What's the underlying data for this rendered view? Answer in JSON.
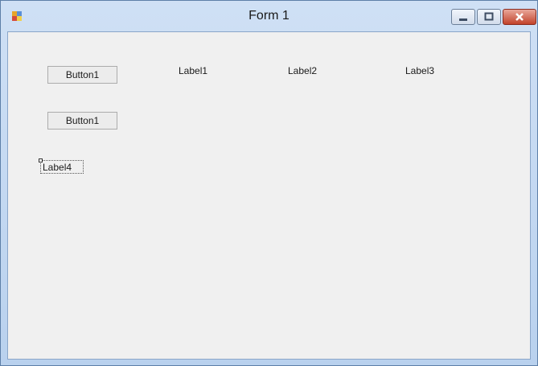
{
  "window": {
    "title": "Form 1",
    "icon": "winforms-form-icon",
    "controls": {
      "minimize": "minimize-icon",
      "maximize": "maximize-icon",
      "close": "close-icon"
    }
  },
  "form": {
    "buttons": [
      {
        "label": "Button1"
      },
      {
        "label": "Button1"
      }
    ],
    "labels": [
      {
        "text": "Label1"
      },
      {
        "text": "Label2"
      },
      {
        "text": "Label3"
      },
      {
        "text": "Label4"
      }
    ]
  },
  "colors": {
    "titlebar": "#cfe0f5",
    "client": "#f0f0f0",
    "close": "#c2432b"
  }
}
